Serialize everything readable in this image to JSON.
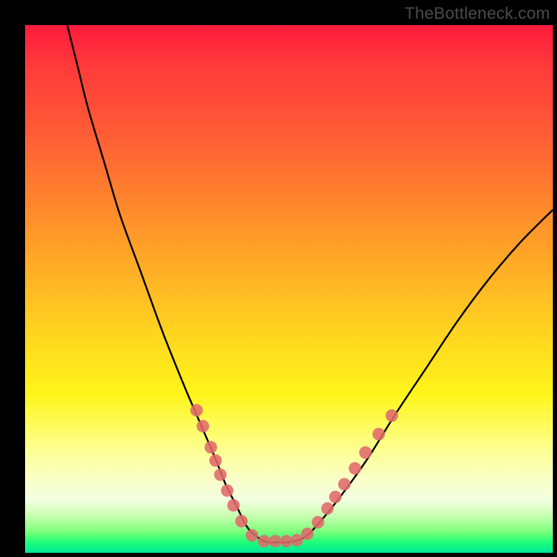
{
  "watermark": "TheBottleneck.com",
  "chart_data": {
    "type": "line",
    "title": "",
    "xlabel": "",
    "ylabel": "",
    "xlim": [
      0,
      100
    ],
    "ylim": [
      0,
      100
    ],
    "series": [
      {
        "name": "curve",
        "x": [
          8,
          10,
          12,
          15,
          18,
          22,
          26,
          30,
          33,
          36,
          38,
          40,
          42,
          44,
          46,
          48,
          50,
          53,
          56,
          60,
          65,
          70,
          76,
          82,
          88,
          94,
          100
        ],
        "y": [
          100,
          92,
          84,
          74,
          64,
          53,
          42,
          32,
          25,
          18,
          13,
          9,
          5,
          3,
          2,
          2,
          2,
          3,
          6,
          11,
          18,
          26,
          35,
          44,
          52,
          59,
          65
        ]
      }
    ],
    "markers": [
      {
        "x": 32.5,
        "y": 27
      },
      {
        "x": 33.7,
        "y": 24
      },
      {
        "x": 35.2,
        "y": 20
      },
      {
        "x": 36.1,
        "y": 17.5
      },
      {
        "x": 37.0,
        "y": 14.8
      },
      {
        "x": 38.3,
        "y": 11.8
      },
      {
        "x": 39.5,
        "y": 9.0
      },
      {
        "x": 41.0,
        "y": 6.0
      },
      {
        "x": 43.0,
        "y": 3.3
      },
      {
        "x": 45.3,
        "y": 2.2
      },
      {
        "x": 47.4,
        "y": 2.2
      },
      {
        "x": 49.5,
        "y": 2.2
      },
      {
        "x": 51.5,
        "y": 2.4
      },
      {
        "x": 53.5,
        "y": 3.6
      },
      {
        "x": 55.5,
        "y": 5.8
      },
      {
        "x": 57.3,
        "y": 8.4
      },
      {
        "x": 58.8,
        "y": 10.6
      },
      {
        "x": 60.5,
        "y": 13.0
      },
      {
        "x": 62.5,
        "y": 16.0
      },
      {
        "x": 64.5,
        "y": 19.0
      },
      {
        "x": 67.0,
        "y": 22.5
      },
      {
        "x": 69.5,
        "y": 26.0
      }
    ],
    "marker_color": "#e06a6a",
    "curve_color": "#000000"
  }
}
